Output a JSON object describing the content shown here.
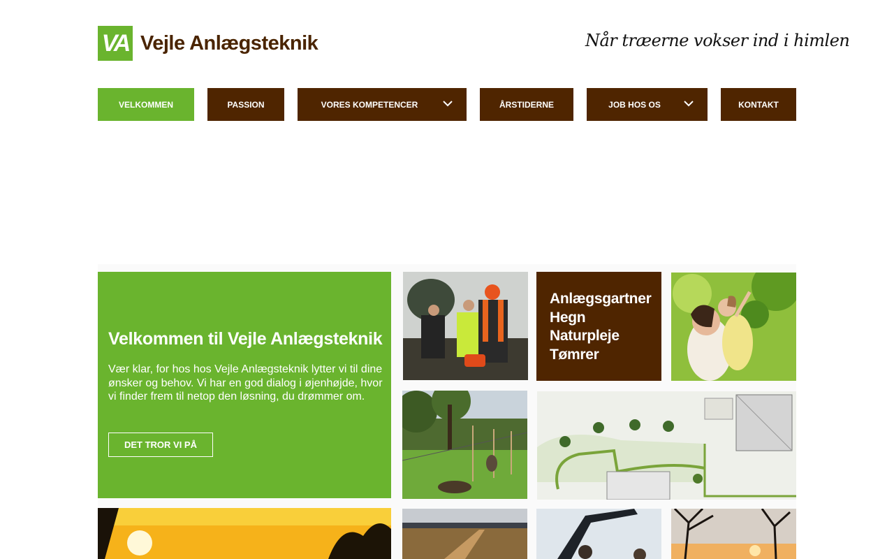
{
  "header": {
    "logo_mark": "VA",
    "logo_text": "Vejle Anlægsteknik",
    "tagline": "Når træerne vokser ind i himlen"
  },
  "nav": {
    "items": [
      {
        "label": "VELKOMMEN",
        "active": true
      },
      {
        "label": "PASSION"
      },
      {
        "label": "VORES KOMPETENCER",
        "has_dropdown": true
      },
      {
        "label": "ÅRSTIDERNE"
      },
      {
        "label": "JOB HOS OS",
        "has_dropdown": true
      },
      {
        "label": "KONTAKT"
      }
    ]
  },
  "hero": {
    "title": "Velkommen til Vejle Anlægsteknik",
    "text": "Vær klar, for hos hos Vejle Anlægsteknik lytter vi til dine ønsker og behov. Vi har en god dialog i øjenhøjde, hvor vi finder frem til netop den løsning, du drømmer om.",
    "cta_label": "DET TROR VI PÅ"
  },
  "services": [
    "Anlægsgartner",
    "Hegn",
    "Naturpleje",
    "Tømrer"
  ],
  "colors": {
    "brand_green": "#6ab42e",
    "brand_brown": "#4f2500"
  }
}
